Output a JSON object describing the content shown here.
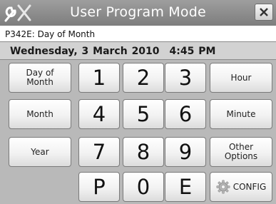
{
  "window": {
    "title": "User Program Mode"
  },
  "param_line": "P342E: Day of Month",
  "datetime": {
    "date": "Wednesday, 3 March 2010",
    "time": "4:45 PM"
  },
  "left_buttons": {
    "day_of_month": "Day of Month",
    "month": "Month",
    "year": "Year"
  },
  "keypad": {
    "k1": "1",
    "k2": "2",
    "k3": "3",
    "k4": "4",
    "k5": "5",
    "k6": "6",
    "k7": "7",
    "k8": "8",
    "k9": "9",
    "kP": "P",
    "k0": "0",
    "kE": "E"
  },
  "right_buttons": {
    "hour": "Hour",
    "minute": "Minute",
    "other_options": "Other Options",
    "config": "CONFIG"
  },
  "icons": {
    "tools": "tools-icon",
    "close": "close-icon",
    "config": "gear-icon"
  }
}
